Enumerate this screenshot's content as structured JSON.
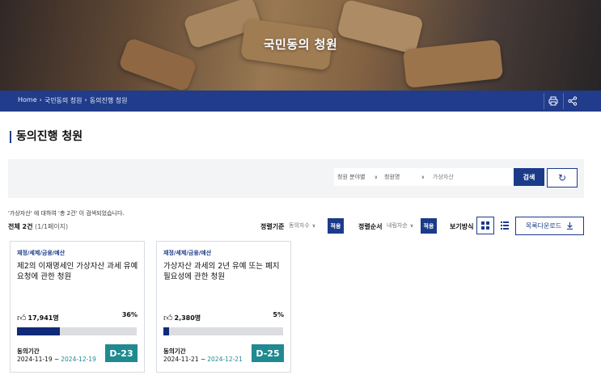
{
  "hero": {
    "title": "국민동의 청원"
  },
  "breadcrumb": [
    "Home",
    "›",
    "국민동의 청원",
    "›",
    "동의진행 청원"
  ],
  "page_title": "동의진행 청원",
  "search": {
    "field_select": "청원 분야별",
    "type_select": "청원명",
    "keyword": "가상자산",
    "search_label": "검색",
    "reset_icon": "refresh-icon"
  },
  "result": {
    "message": "'가상자산' 에 대하여 '총 2건' 이 검색되었습니다.",
    "total_label": "전체 2건",
    "pages": "(1/1페이지)"
  },
  "controls": {
    "sort_basis_label": "정렬기준",
    "sort_basis_value": "동의자수",
    "apply_label": "적용",
    "sort_order_label": "정렬순서",
    "sort_order_value": "내림차순",
    "view_label": "보기방식",
    "download_label": "목록다운로드",
    "download_icon": "download-icon"
  },
  "cards": [
    {
      "category": "재정/세제/금융/예산",
      "title": "제2의 이재명세인 가상자산 과세 유예 요청에 관한 청원",
      "likes": "17,941명",
      "percent": "36%",
      "progress": 0.36,
      "period_label": "동의기간",
      "start": "2024-11-19 ~",
      "end": "2024-12-19",
      "dday": "D-23"
    },
    {
      "category": "재정/세제/금융/예산",
      "title": "가상자산 과세의 2년 유예 또는 폐지 필요성에 관한 청원",
      "likes": "2,380명",
      "percent": "5%",
      "progress": 0.05,
      "period_label": "동의기간",
      "start": "2024-11-21 ~",
      "end": "2024-12-21",
      "dday": "D-25"
    }
  ],
  "colors": {
    "brand": "#1b3b8a",
    "accent": "#1f8a8f",
    "bar_fill": "#0f2a78"
  }
}
